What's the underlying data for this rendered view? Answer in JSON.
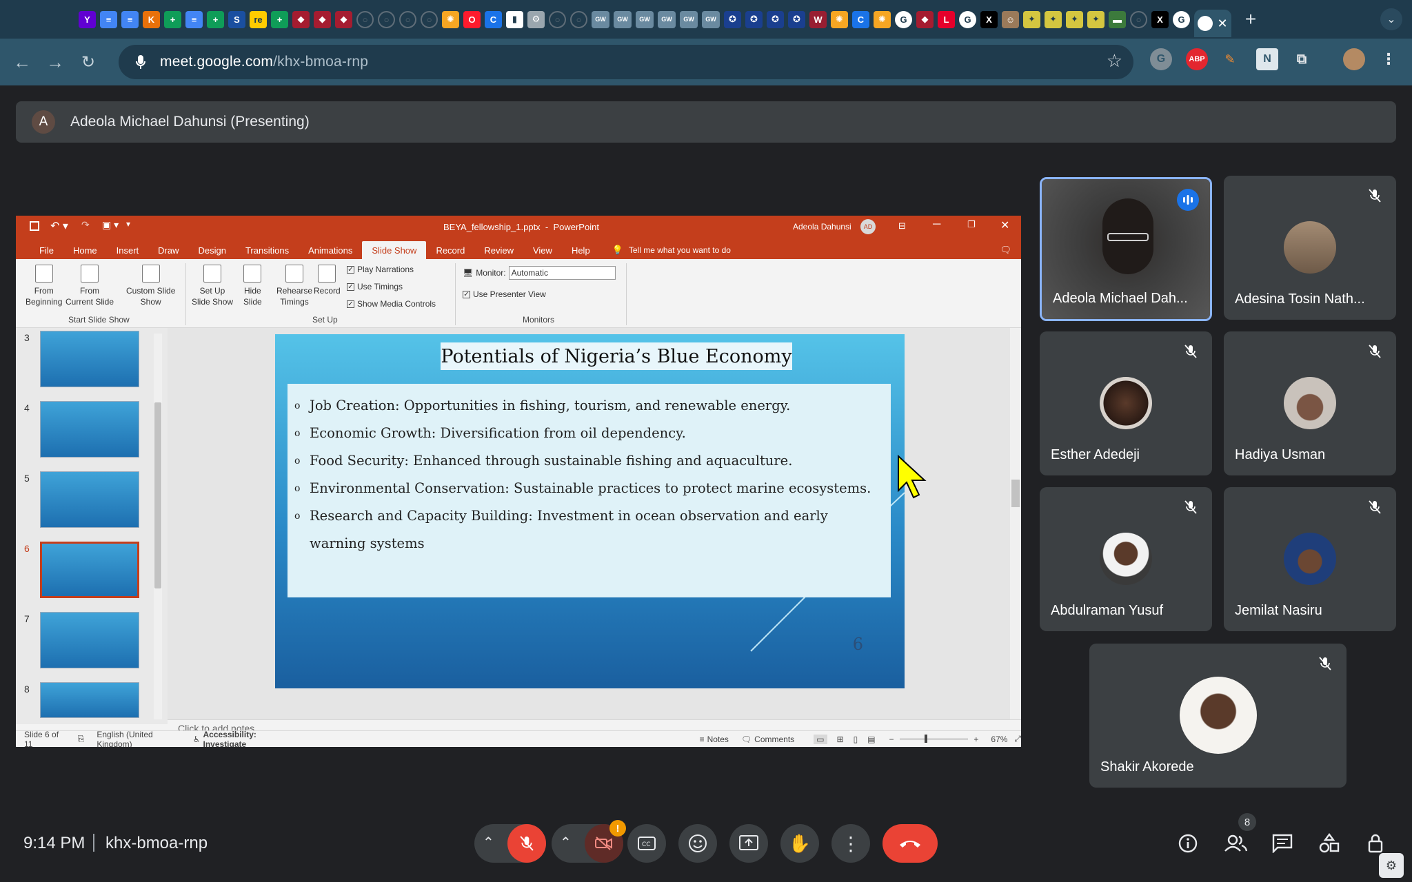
{
  "browser": {
    "url_host": "meet.google.com",
    "url_path": "/khx-bmoa-rnp",
    "tab_favicons": [
      "yahoo",
      "docs",
      "docs",
      "krc",
      "sheets",
      "docs",
      "sheets",
      "s",
      "re",
      "sheets",
      "crest",
      "crest",
      "crest",
      "globe",
      "globe",
      "globe",
      "globe",
      "sun",
      "opera",
      "c",
      "t",
      "settings",
      "globe",
      "globe",
      "gw",
      "gw",
      "gw",
      "gw",
      "gw",
      "gw",
      "seal",
      "seal",
      "seal",
      "seal",
      "wsu",
      "sun",
      "c",
      "sun",
      "google",
      "crest",
      "lse",
      "google",
      "x",
      "avatar",
      "bird",
      "bird",
      "bird",
      "bird",
      "dash",
      "globe",
      "x",
      "google"
    ],
    "extensions": {
      "abp": "ABP"
    }
  },
  "presenter_bar": {
    "avatar_letter": "A",
    "label": "Adeola Michael Dahunsi (Presenting)"
  },
  "ppt": {
    "filename": "BEYA_fellowship_1.pptx  -  PowerPoint",
    "user": "Adeola Dahunsi",
    "user_initials": "AD",
    "tabs": [
      "File",
      "Home",
      "Insert",
      "Draw",
      "Design",
      "Transitions",
      "Animations",
      "Slide Show",
      "Record",
      "Review",
      "View",
      "Help"
    ],
    "tell_me": "Tell me what you want to do",
    "ribbon": {
      "from_beginning": "From\nBeginning",
      "from_current": "From\nCurrent Slide",
      "custom_show": "Custom Slide\nShow",
      "group1": "Start Slide Show",
      "setup_show": "Set Up\nSlide Show",
      "hide_slide": "Hide\nSlide",
      "rehearse": "Rehearse\nTimings",
      "record": "Record",
      "play_narrations": "Play Narrations",
      "use_timings": "Use Timings",
      "show_media": "Show Media Controls",
      "group2": "Set Up",
      "monitor_label": "Monitor:",
      "monitor_value": "Automatic",
      "presenter_view": "Use Presenter View",
      "group3": "Monitors"
    },
    "thumb_numbers": [
      "3",
      "4",
      "5",
      "6",
      "7",
      "8"
    ],
    "slide": {
      "title": "Potentials of Nigeria’s Blue Economy",
      "bullets": [
        "Job Creation: Opportunities in fishing, tourism, and renewable energy.",
        "Economic Growth: Diversification from oil dependency.",
        "Food Security: Enhanced through sustainable fishing and aquaculture.",
        "Environmental Conservation: Sustainable practices to protect marine ecosystems.",
        "Research and Capacity Building: Investment in ocean observation and early warning systems"
      ],
      "number": "6"
    },
    "notes_placeholder": "Click to add notes",
    "status": {
      "slide_of": "Slide 6 of 11",
      "language": "English (United Kingdom)",
      "accessibility": "Accessibility: Investigate",
      "notes": "Notes",
      "comments": "Comments",
      "zoom": "67%"
    }
  },
  "participants": [
    {
      "name": "Adeola Michael Dah...",
      "speaking": true
    },
    {
      "name": "Adesina Tosin Nath...",
      "muted": true
    },
    {
      "name": "Esther Adedeji",
      "muted": true
    },
    {
      "name": "Hadiya Usman",
      "muted": true
    },
    {
      "name": "Abdulraman Yusuf",
      "muted": true
    },
    {
      "name": "Jemilat Nasiru",
      "muted": true
    },
    {
      "name": "Shakir Akorede",
      "muted": true
    }
  ],
  "bottom": {
    "time": "9:14 PM",
    "meeting_code": "khx-bmoa-rnp",
    "people_count": "8",
    "camera_alert": "!"
  },
  "colors": {
    "end_call": "#ea4335",
    "muted_red": "#ea4335",
    "ppt_red": "#c43e1c",
    "speaking_blue": "#8ab4f8"
  }
}
